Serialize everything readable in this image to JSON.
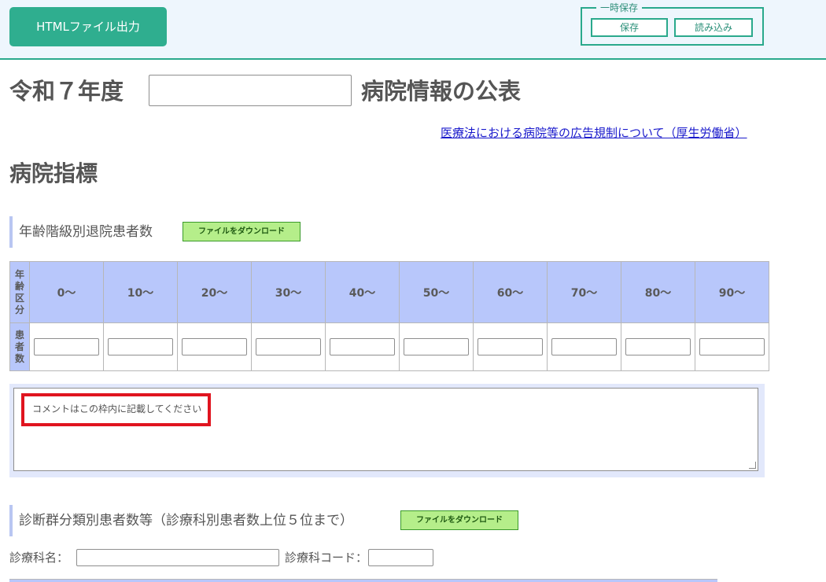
{
  "toolbar": {
    "export_label": "HTMLファイル出力",
    "temp_save_legend": "一時保存",
    "save_label": "保存",
    "load_label": "読み込み"
  },
  "header": {
    "title_prefix": "令和７年度",
    "hospital_name_value": "",
    "title_suffix": "病院情報の公表",
    "law_link": "医療法における病院等の広告規制について（厚生労働省）"
  },
  "section": {
    "title": "病院指標"
  },
  "age_table": {
    "heading": "年齢階級別退院患者数",
    "download_label": "ファイルをダウンロード",
    "row_header_age": "年齢区分",
    "row_header_count": "患者数",
    "columns": [
      "0～",
      "10～",
      "20～",
      "30～",
      "40～",
      "50～",
      "60～",
      "70～",
      "80～",
      "90～"
    ],
    "values": [
      "",
      "",
      "",
      "",
      "",
      "",
      "",
      "",
      "",
      ""
    ]
  },
  "comment": {
    "placeholder": "コメントはこの枠内に記載してください"
  },
  "diagnosis": {
    "heading": "診断群分類別患者数等（診療科別患者数上位５位まで）",
    "download_label": "ファイルをダウンロード",
    "dept_name_label": "診療科名：",
    "dept_name_value": "",
    "dept_code_label": "診療科コード：",
    "dept_code_value": ""
  },
  "colors": {
    "accent": "#2fae8f",
    "table_header": "#b8c7fb",
    "download_button": "#b5ee8a",
    "highlight_border": "#e0141f",
    "link": "#1a1acc"
  }
}
